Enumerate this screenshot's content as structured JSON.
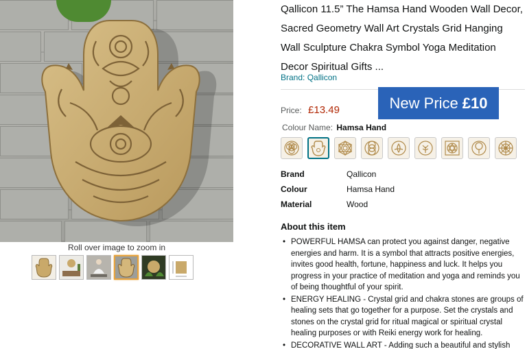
{
  "product": {
    "title": "Qallicon 11.5” The Hamsa Hand Wooden Wall Decor, Sacred Geometry Wall Art Crystals Grid Hanging Wall Sculpture Chakra Symbol Yoga Meditation Decor Spiritual Gifts ...",
    "brand_link": "Brand: Qallicon"
  },
  "gallery": {
    "zoom_hint": "Roll over image to zoom in",
    "thumbnails": [
      {
        "icon": "hamsa-thumb"
      },
      {
        "icon": "room-thumb"
      },
      {
        "icon": "meditation-thumb"
      },
      {
        "icon": "hamsa-gold-thumb",
        "selected": true
      },
      {
        "icon": "plant-thumb"
      },
      {
        "icon": "dimensions-thumb"
      }
    ]
  },
  "pricing": {
    "label": "Price:",
    "value": "£13.49",
    "promo_prefix": "New Price",
    "promo_value": "£10"
  },
  "colour": {
    "label": "Colour Name:",
    "value": "Hamsa Hand",
    "swatch_count": 9,
    "selected_index": 1
  },
  "specs": [
    {
      "key": "Brand",
      "value": "Qallicon"
    },
    {
      "key": "Colour",
      "value": "Hamsa Hand"
    },
    {
      "key": "Material",
      "value": "Wood"
    }
  ],
  "about": {
    "heading": "About this item",
    "bullets": [
      "POWERFUL HAMSA can protect you against danger, negative energies and harm. It is a symbol that attracts positive energies, invites good health, fortune, happiness and luck. It helps you progress in your practice of meditation and yoga and reminds you of being thoughtful of your spirit.",
      "ENERGY HEALING - Crystal grid and chakra stones are groups of healing sets that go together for a purpose. Set the crystals and stones on the crystal grid for ritual magical or spiritual crystal healing purposes or with Reiki energy work for healing.",
      "DECORATIVE WALL ART - Adding such a beautiful and stylish"
    ]
  },
  "colors": {
    "price_red": "#b12704",
    "link_teal": "#007185",
    "promo_blue": "#2a63b8",
    "wood_gold": "#c9a96a"
  }
}
